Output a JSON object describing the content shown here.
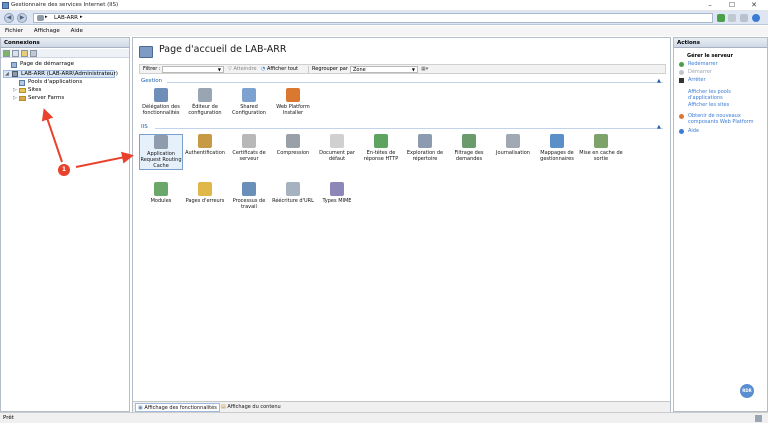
{
  "window": {
    "title": "Gestionnaire des services Internet (IIS)",
    "min": "–",
    "max": "☐",
    "close": "✕"
  },
  "address": {
    "path": "LAB-ARR",
    "sep": "▸"
  },
  "menu": [
    "Fichier",
    "Affichage",
    "Aide"
  ],
  "connections": {
    "title": "Connexions",
    "tree": {
      "start": "Page de démarrage",
      "server": "LAB-ARR (LAB-ARR\\Administrateur)",
      "pools": "Pools d'applications",
      "sites": "Sites",
      "farms": "Server Farms"
    }
  },
  "main": {
    "title": "Page d'accueil de LAB-ARR",
    "filter_label": "Filtrer :",
    "goto": "Atteindre",
    "show_all": "Afficher tout",
    "group_by": "Regrouper par :",
    "group_value": "Zone",
    "sections": {
      "gestion": {
        "name": "Gestion",
        "items": [
          {
            "label": "Délégation des fonctionnalités",
            "icon": "delegation-icon",
            "color": "#6f8fb8"
          },
          {
            "label": "Éditeur de configuration",
            "icon": "config-editor-icon",
            "color": "#9aa5b3"
          },
          {
            "label": "Shared Configuration",
            "icon": "shared-config-icon",
            "color": "#7ea2cf"
          },
          {
            "label": "Web Platform Installer",
            "icon": "web-platform-icon",
            "color": "#d9782e"
          }
        ]
      },
      "iis": {
        "name": "IIS",
        "items": [
          {
            "label": "Application Request Routing Cache",
            "icon": "arr-cache-icon",
            "color": "#8f9cae"
          },
          {
            "label": "Authentification",
            "icon": "authentication-icon",
            "color": "#c79a45"
          },
          {
            "label": "Certificats de serveur",
            "icon": "certificate-icon",
            "color": "#b8b8b8"
          },
          {
            "label": "Compression",
            "icon": "compression-icon",
            "color": "#9aa0a8"
          },
          {
            "label": "Document par défaut",
            "icon": "default-document-icon",
            "color": "#d0d0d0"
          },
          {
            "label": "En-têtes de réponse HTTP",
            "icon": "http-headers-icon",
            "color": "#5ea35e"
          },
          {
            "label": "Exploration de répertoire",
            "icon": "directory-browsing-icon",
            "color": "#8d9bb0"
          },
          {
            "label": "Filtrage des demandes",
            "icon": "request-filtering-icon",
            "color": "#6b9b6b"
          },
          {
            "label": "Journalisation",
            "icon": "logging-icon",
            "color": "#a0a8b4"
          },
          {
            "label": "Mappages de gestionnaires",
            "icon": "handler-mappings-icon",
            "color": "#5a8fc8"
          },
          {
            "label": "Mise en cache de sortie",
            "icon": "output-cache-icon",
            "color": "#7da36a"
          },
          {
            "label": "Modules",
            "icon": "modules-icon",
            "color": "#6aa86a"
          },
          {
            "label": "Pages d'erreurs",
            "icon": "error-pages-icon",
            "color": "#e0b84a"
          },
          {
            "label": "Processus de travail",
            "icon": "worker-process-icon",
            "color": "#6a8fb8"
          },
          {
            "label": "Réécriture d'URL",
            "icon": "url-rewrite-icon",
            "color": "#a6b2c0"
          },
          {
            "label": "Types MIME",
            "icon": "mime-types-icon",
            "color": "#8d86b8"
          }
        ]
      }
    },
    "tabs": {
      "features": "Affichage des fonctionnalités",
      "content": "Affichage du contenu"
    }
  },
  "actions": {
    "title": "Actions",
    "manage": "Gérer le serveur",
    "restart": "Redémarrer",
    "start": "Démarrer",
    "stop": "Arrêter",
    "show_pools": "Afficher les pools d'applications",
    "show_sites": "Afficher les sites",
    "get_components": "Obtenir de nouveaux composants Web Platform",
    "help": "Aide"
  },
  "status": "Prêt",
  "annotation": {
    "badge": "1"
  },
  "rdr_badge": "RDR"
}
